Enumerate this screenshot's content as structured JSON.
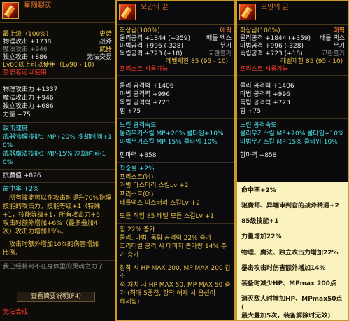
{
  "panel_cn": {
    "title": "星陨裂灭",
    "lines": [
      {
        "l": "最上级（100%)",
        "r": "史诗",
        "c": "gold"
      },
      {
        "l": "物理攻击 +1738",
        "r": "战斧",
        "c": "white"
      },
      {
        "l": "魔法攻击 +946",
        "r": "武器",
        "c": "grey"
      },
      {
        "l": "独立攻击 +886",
        "r": "无法交易",
        "c": "white"
      }
    ],
    "level_req": "Lv80以上可以使用（Lv90 - 10)",
    "limit": "圣职者可以使用",
    "stats": [
      "物理攻击力 +1337",
      "魔法攻击力 +946",
      "独立攻击力 +686",
      "力量 +75"
    ],
    "speed": [
      "攻击速度",
      "武器物理技能：MP+20% 冷却时间+1",
      "0%",
      "武器魔法技能：MP-15% 冷却时间-1",
      "0%"
    ],
    "hp": "抗魔值 +826",
    "crit": "命中率 +2%",
    "desc": [
      "　所有技能可以在攻击时提升70%物理",
      "技能的攻击力，技能等级+1（特殊",
      "+1，技能等级+1，所有攻击力+6",
      "攻击时额外增加+6%（最多叠加4",
      "次）攻击力增加15%。"
    ],
    "desc2": [
      "　攻击时额外增加10%的伤害增加",
      "比例。"
    ],
    "quote": "我已经将到不在身体里的灵魂之力了",
    "button": "查看简要说明(F4)",
    "footer": "无法合成"
  },
  "panel_kr": {
    "title": "오만의 끝",
    "lines": [
      {
        "l": "최상급(100%)",
        "r": "에픽",
        "c": "gold"
      },
      {
        "l": "물리공격 +1844 (+359)",
        "r": "배틀 액스",
        "c": "white"
      },
      {
        "l": "마법공격 +996 (-328)",
        "r": "무기",
        "c": "white"
      },
      {
        "l": "독립공격 +723 (+18)",
        "r": "교환불가",
        "c": "white"
      },
      {
        "l": "레벨제한 85 (95 - 10)",
        "r": "",
        "c": "gold"
      }
    ],
    "usable": "프리스트 사용가능",
    "stats": [
      "물리 공격력 +1406",
      "마법 공격력 +996",
      "독립 공격력 +723",
      "힘 +75"
    ],
    "speed": [
      "느린 공격속도",
      "물리무기스킬 MP+20% 쿨타임+10%",
      "마법무기스킬 MP-15% 쿨타임-10%"
    ],
    "hp": "항마력 +858",
    "crit": "적중률 +2%",
    "class_lines": [
      "프리스트(남)",
      "거병 마스터리 스킬Lv +2",
      "프리스트(여)",
      "배틀액스 마스터리 스킬Lv +2"
    ],
    "all_skill": "모든 직업 85 레벨 모든 스킬Lv +1",
    "bonus": [
      "힘 22% 증가",
      "물리, 마법, 독립 공격력 22% 증가",
      "크리티컬 공격 시 데미지 증가량 14% 추",
      "가 증가"
    ],
    "reduce": [
      "장착 시 HP MAX 200, MP MAX 200 감",
      "소",
      "적 처치 시 HP MAX 50, MP MAX 50 증",
      "가 (최대 5중첩, 장착 해제 시 옵션이",
      "해제됨)"
    ]
  },
  "panel_trans": {
    "title": "오만의 끝",
    "lines": [
      {
        "l": "최상급(100%)",
        "r": "에픽",
        "c": "gold"
      },
      {
        "l": "물리공격 +1844 (+359)",
        "r": "배틀 액스",
        "c": "white"
      },
      {
        "l": "마법공격 +996 (-328)",
        "r": "무기",
        "c": "white"
      },
      {
        "l": "독립공격 +723 (+18)",
        "r": "교환불가",
        "c": "white"
      },
      {
        "l": "레벨제한 85 (95 - 10)",
        "r": "",
        "c": "gold"
      }
    ],
    "usable": "프리스트 사용가능",
    "stats": [
      "물리 공격력 +1406",
      "마법 공격력 +996",
      "독립 공격력 +723",
      "힘 +75"
    ],
    "speed": [
      "느린 공격속도",
      "물리무기스킬 MP+20% 쿨타임+10%",
      "마법무기스킬 MP-15% 쿨타임-10%"
    ],
    "hp": "항마력 +858",
    "notes": [
      "命中率+2%",
      "驱魔师、异端审判官的战斧精通+2",
      "85级技能+1",
      "力量增加22%",
      "物理、魔法、独立攻击力增加22%",
      "暴击攻击时伤害额外增加14%",
      "装备时减少HP、MPmax 200点",
      "消灭敌人时增加HP、MPmax50点(",
      "最大叠加5次，装备解除时无效)"
    ]
  }
}
